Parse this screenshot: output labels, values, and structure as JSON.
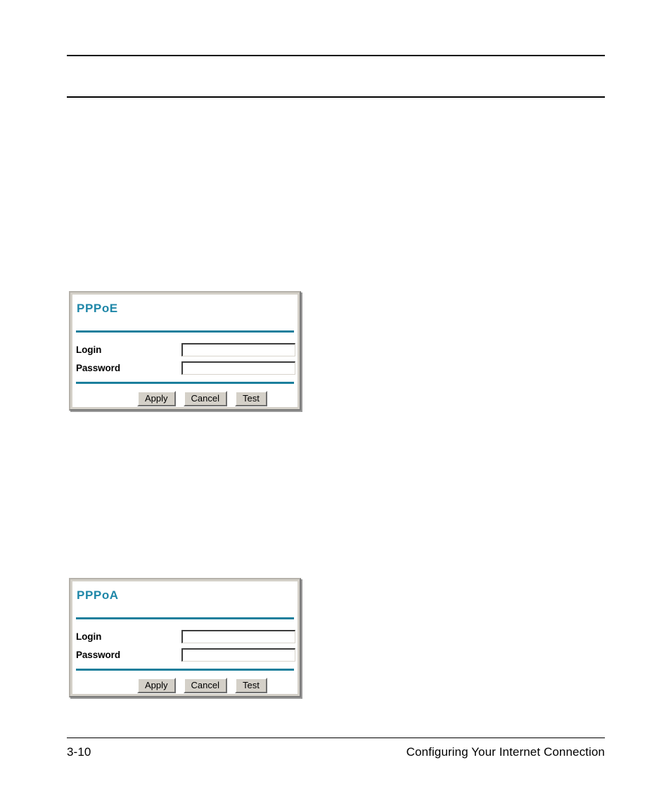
{
  "page": {
    "footer_page_number": "3-10",
    "footer_title": "Configuring Your Internet Connection"
  },
  "theme": {
    "accent_teal": "#1f87a8",
    "rule_teal": "#1c7f9c",
    "panel_face": "#d4d0c8",
    "text": "#000000"
  },
  "panels": [
    {
      "id": "pppoe",
      "title": "PPPoE",
      "fields": [
        {
          "label": "Login",
          "value": "",
          "placeholder": ""
        },
        {
          "label": "Password",
          "value": "",
          "placeholder": ""
        }
      ],
      "buttons": [
        {
          "label": "Apply"
        },
        {
          "label": "Cancel"
        },
        {
          "label": "Test"
        }
      ]
    },
    {
      "id": "pppoa",
      "title": "PPPoA",
      "fields": [
        {
          "label": "Login",
          "value": "",
          "placeholder": ""
        },
        {
          "label": "Password",
          "value": "",
          "placeholder": ""
        }
      ],
      "buttons": [
        {
          "label": "Apply"
        },
        {
          "label": "Cancel"
        },
        {
          "label": "Test"
        }
      ]
    }
  ]
}
